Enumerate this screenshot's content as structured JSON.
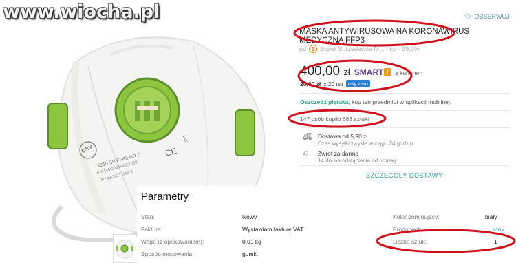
{
  "watermark": "www.wiocha.pl",
  "header": {
    "observe_label": "OBSERWUJ"
  },
  "product": {
    "title": "MASKA ANTYWIRUSOWA NA KORONAWIRUS MEDYCZNA FFP3",
    "seller_prefix": "od",
    "seller_badge": "S",
    "seller_name": "Super Sprzedawca  M...  ·  cp  · 99,9%",
    "price_main": "400,00",
    "price_currency": "zł",
    "smart_label": "SMART",
    "smart_bang": "!",
    "courier": "z kurierem",
    "installment_text": "20,00 zł",
    "installment_suffix": "x 20 rat",
    "raty_badge": "raty zero",
    "promo_bold": "Oszczędź piątaka",
    "promo_rest": ", kup ten przedmiot w aplikacji mobilnej.",
    "bought": "147 osób kupiło 683 sztuki"
  },
  "delivery": [
    {
      "icon": "truck-icon",
      "line1": "Dostawa od 5,90 zł",
      "line2": "Czas wysyłki zwykle w ciągu 24 godzin"
    },
    {
      "icon": "return-icon",
      "line1": "Zwrot za darmo",
      "line2": "14 dni na odstąpienie od umowy"
    }
  ],
  "shipping_details_label": "SZCZEGÓŁY DOSTAWY",
  "mask_print": {
    "brand": "OXY",
    "model": "X210 SV FFP3 NR D",
    "standard": "EN 149:2001+A1:2009",
    "date": "30-09-2011 02201",
    "ce": "CE",
    "code": "1437"
  },
  "params": {
    "title": "Parametry",
    "left": [
      {
        "label": "Stan:",
        "value": "Nowy"
      },
      {
        "label": "Faktura:",
        "value": "Wystawiam fakturę VAT"
      },
      {
        "label": "Waga (z opakowaniem):",
        "value": "0.01 kg"
      },
      {
        "label": "Sposób mocowania:",
        "value": "gumki"
      }
    ],
    "right": [
      {
        "label": "Kolor dominujący:",
        "value": "biały"
      },
      {
        "label": "Producent:",
        "value": "inny"
      },
      {
        "label": "Liczba sztuk:",
        "value": "1"
      }
    ]
  },
  "colors": {
    "accent": "#2ba38c",
    "annotation": "#d0101a",
    "smart": "#5b3e8c",
    "valve": "#7cb342"
  }
}
